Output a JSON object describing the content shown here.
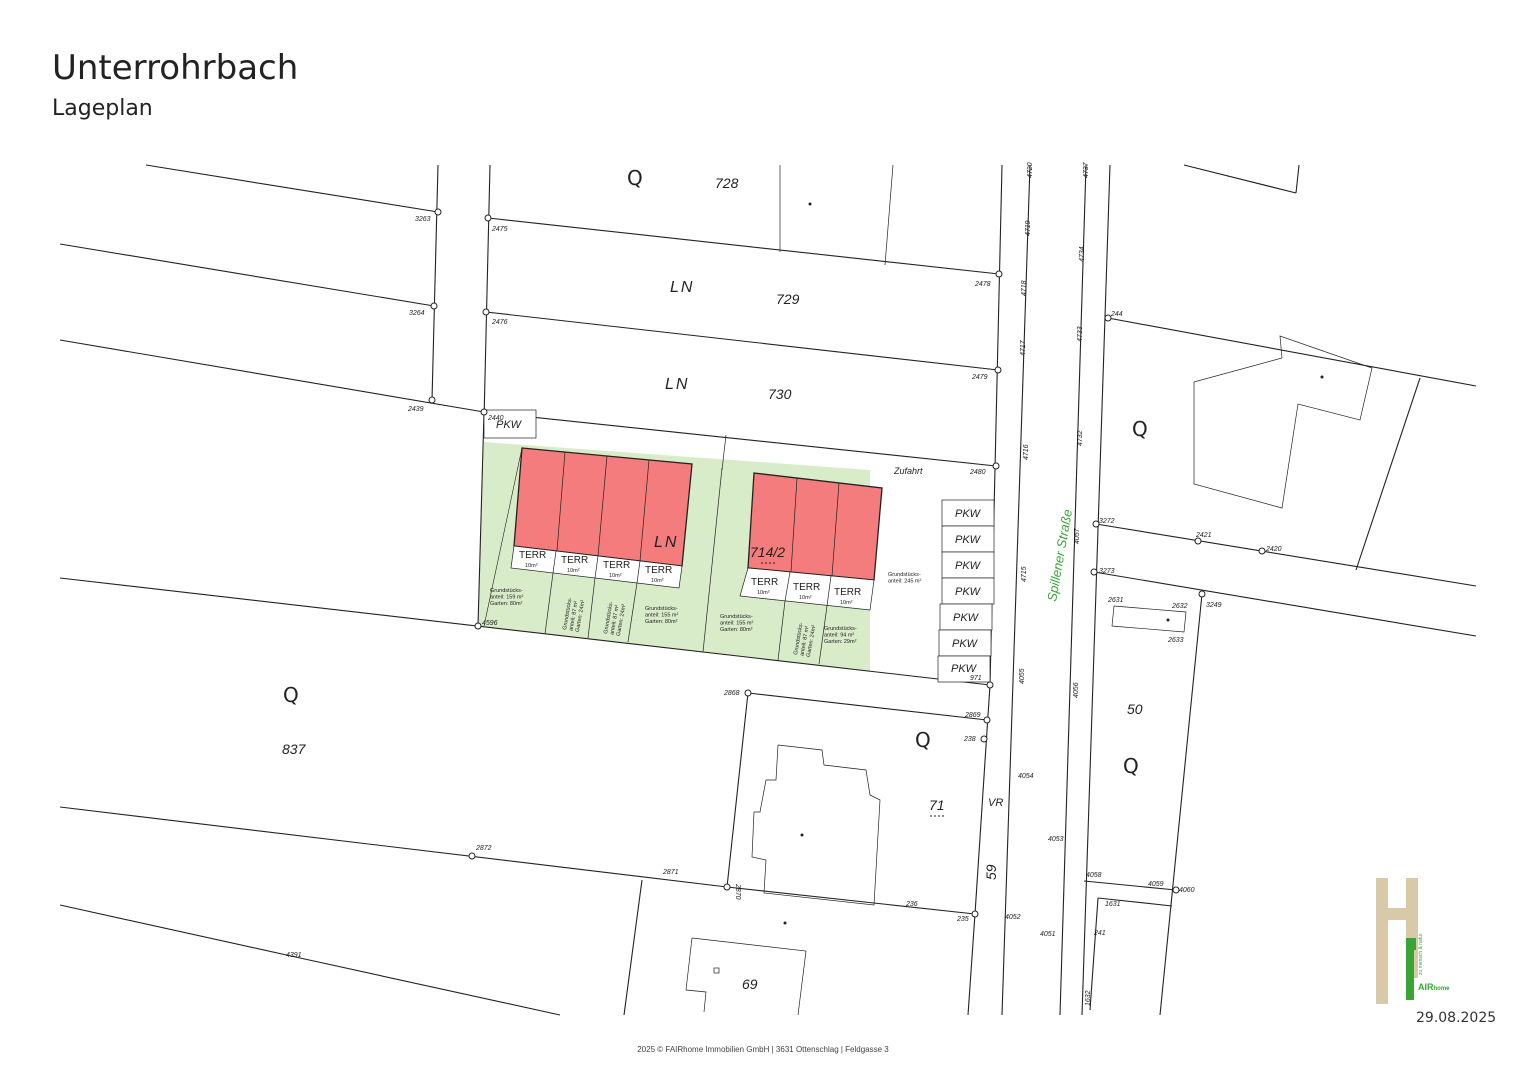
{
  "header": {
    "title": "Unterrohrbach",
    "subtitle": "Lageplan"
  },
  "map": {
    "parcels": {
      "p728": "728",
      "p729": "729",
      "p730": "730",
      "p837": "837",
      "p50": "50",
      "p71": "71",
      "p69": "69",
      "p714": "714/2",
      "p59": "59"
    },
    "usage": {
      "ln": "LN",
      "q": "Q",
      "vr": "VR"
    },
    "street": "Spillener Straße",
    "zufahrt": "Zufahrt",
    "pkw": "PKW",
    "terr": "TERR",
    "terr_area": "10m²",
    "shared_area": "Grundstücks-\nanteil: 245 m²",
    "lot_notes": [
      "Grundstücks-\nanteil: 159 m²\nGarten: 80m²",
      "Grundstücks-\nanteil: 87 m²\nGarten: 24m²",
      "Grundstücks-\nanteil: 87 m²\nGarten: 24m²",
      "Grundstücks-\nanteil: 155 m²\nGarten: 80m²",
      "Grundstücks-\nanteil: 155 m²\nGarten: 80m²",
      "Grundstücks-\nanteil: 87 m²\nGarten: 24m²",
      "Grundstücks-\nanteil: 94 m²\nGarten: 29m²"
    ],
    "points": [
      "3263",
      "3264",
      "2439",
      "2475",
      "2476",
      "2440",
      "4596",
      "2478",
      "2479",
      "2480",
      "971",
      "2868",
      "2869",
      "238",
      "2872",
      "2871",
      "2870",
      "236",
      "235",
      "4391",
      "4720",
      "4719",
      "4718",
      "4717",
      "4716",
      "4715",
      "4055",
      "4054",
      "4053",
      "4052",
      "4051",
      "4737",
      "4734",
      "4733",
      "4732",
      "4057",
      "4056",
      "244",
      "3272",
      "2421",
      "2420",
      "3273",
      "3249",
      "2631",
      "2632",
      "2633",
      "4058",
      "4059",
      "4060",
      "1631",
      "241",
      "1632"
    ],
    "colors": {
      "house": "#f47c7c",
      "garden": "#d9ecc9",
      "street_label": "#3aa535"
    }
  },
  "logo": {
    "brand": "AIR",
    "brand_suffix": "home",
    "tagline": "zu mensch & natur"
  },
  "date": "29.08.2025",
  "footer": "2025 © FAIRhome Immobilien GmbH | 3631 Ottenschlag | Feldgasse 3"
}
